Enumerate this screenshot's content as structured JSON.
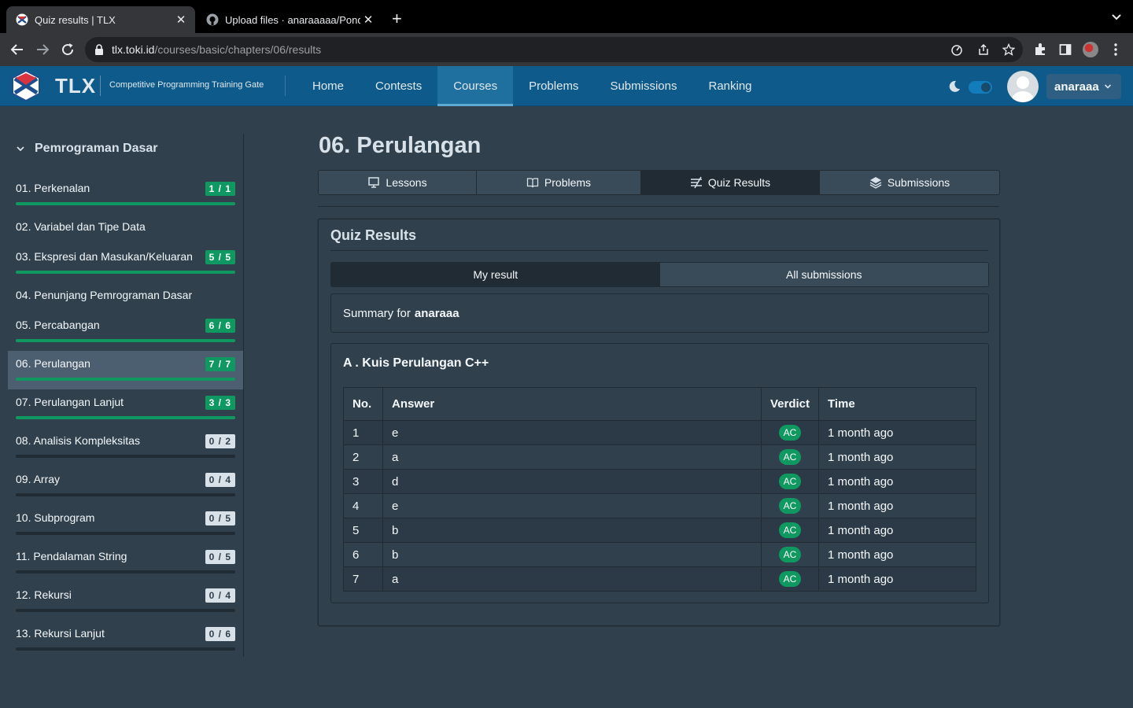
{
  "browser": {
    "tabs": [
      {
        "title": "Quiz results | TLX",
        "active": true
      },
      {
        "title": "Upload files · anaraaaaa/Pond",
        "active": false
      }
    ],
    "new_tab": "+",
    "url_host": "tlx.toki.id",
    "url_path": "/courses/basic/chapters/06/results"
  },
  "navbar": {
    "brand": "TLX",
    "subtitle": "Competitive Programming Training Gate",
    "links": [
      "Home",
      "Contests",
      "Courses",
      "Problems",
      "Submissions",
      "Ranking"
    ],
    "active_link": "Courses",
    "username": "anaraaa"
  },
  "sidebar": {
    "course_title": "Pemrograman Dasar",
    "chapters": [
      {
        "label": "01. Perkenalan",
        "badge": "1 / 1",
        "progress": 1.0
      },
      {
        "label": "02. Variabel dan Tipe Data",
        "badge": "",
        "progress": null
      },
      {
        "label": "03. Ekspresi dan Masukan/Keluaran",
        "badge": "5 / 5",
        "progress": 1.0
      },
      {
        "label": "04. Penunjang Pemrograman Dasar",
        "badge": "",
        "progress": null
      },
      {
        "label": "05. Percabangan",
        "badge": "6 / 6",
        "progress": 1.0
      },
      {
        "label": "06. Perulangan",
        "badge": "7 / 7",
        "progress": 1.0
      },
      {
        "label": "07. Perulangan Lanjut",
        "badge": "3 / 3",
        "progress": 1.0
      },
      {
        "label": "08. Analisis Kompleksitas",
        "badge": "0 / 2",
        "progress": 0
      },
      {
        "label": "09. Array",
        "badge": "0 / 4",
        "progress": 0
      },
      {
        "label": "10. Subprogram",
        "badge": "0 / 5",
        "progress": 0
      },
      {
        "label": "11. Pendalaman String",
        "badge": "0 / 5",
        "progress": 0
      },
      {
        "label": "12. Rekursi",
        "badge": "0 / 4",
        "progress": 0
      },
      {
        "label": "13. Rekursi Lanjut",
        "badge": "0 / 6",
        "progress": 0
      }
    ],
    "active_chapter": "06. Perulangan"
  },
  "main": {
    "title": "06. Perulangan",
    "tabs": [
      "Lessons",
      "Problems",
      "Quiz Results",
      "Submissions"
    ],
    "active_tab": "Quiz Results",
    "card_title": "Quiz Results",
    "segments": [
      "My result",
      "All submissions"
    ],
    "active_segment": "My result",
    "summary_prefix": "Summary for",
    "summary_user": "anaraaa",
    "quiz_title": "A . Kuis Perulangan C++",
    "table": {
      "headers": [
        "No.",
        "Answer",
        "Verdict",
        "Time"
      ],
      "rows": [
        [
          "1",
          "e",
          "AC",
          "1 month ago"
        ],
        [
          "2",
          "a",
          "AC",
          "1 month ago"
        ],
        [
          "3",
          "d",
          "AC",
          "1 month ago"
        ],
        [
          "4",
          "e",
          "AC",
          "1 month ago"
        ],
        [
          "5",
          "b",
          "AC",
          "1 month ago"
        ],
        [
          "6",
          "b",
          "AC",
          "1 month ago"
        ],
        [
          "7",
          "a",
          "AC",
          "1 month ago"
        ]
      ]
    }
  },
  "colors": {
    "navbar": "#0e5a8a",
    "page_bg": "#30404d",
    "success": "#0f9960"
  },
  "icons": [
    "tlx-favicon",
    "github-favicon",
    "back-icon",
    "forward-icon",
    "reload-icon",
    "lock-icon",
    "share-icon",
    "star-icon",
    "extensions-icon",
    "sidebar-icon",
    "menu-icon",
    "moon-icon",
    "chevron-down-icon",
    "lessons-icon",
    "book-icon",
    "quiz-icon",
    "layers-icon"
  ]
}
